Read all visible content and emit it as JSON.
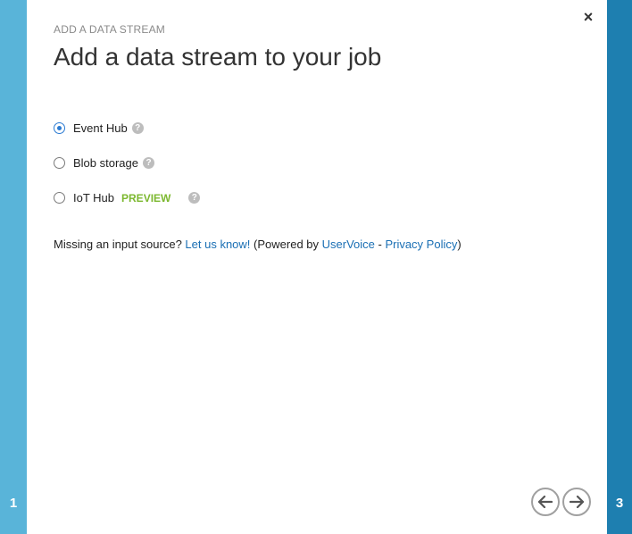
{
  "steps": {
    "current_left": "1",
    "next_right": "3"
  },
  "header": {
    "eyebrow": "ADD A DATA STREAM",
    "title": "Add a data stream to your job",
    "close_icon": "close-icon"
  },
  "options": [
    {
      "label": "Event Hub",
      "checked": true,
      "badge": ""
    },
    {
      "label": "Blob storage",
      "checked": false,
      "badge": ""
    },
    {
      "label": "IoT Hub",
      "checked": false,
      "badge": "PREVIEW"
    }
  ],
  "help_glyph": "?",
  "note": {
    "prefix": "Missing an input source? ",
    "link1": "Let us know!",
    "middle": " (Powered by ",
    "link2": "UserVoice",
    "sep": " - ",
    "link3": "Privacy Policy",
    "suffix": ")"
  },
  "colors": {
    "left_rail": "#59b4d9",
    "right_rail": "#1e7fb0",
    "accent": "#2a7ad2",
    "preview": "#7cb82f",
    "link": "#1a6fb4"
  },
  "nav": {
    "back_icon": "arrow-left-icon",
    "next_icon": "arrow-right-icon"
  }
}
